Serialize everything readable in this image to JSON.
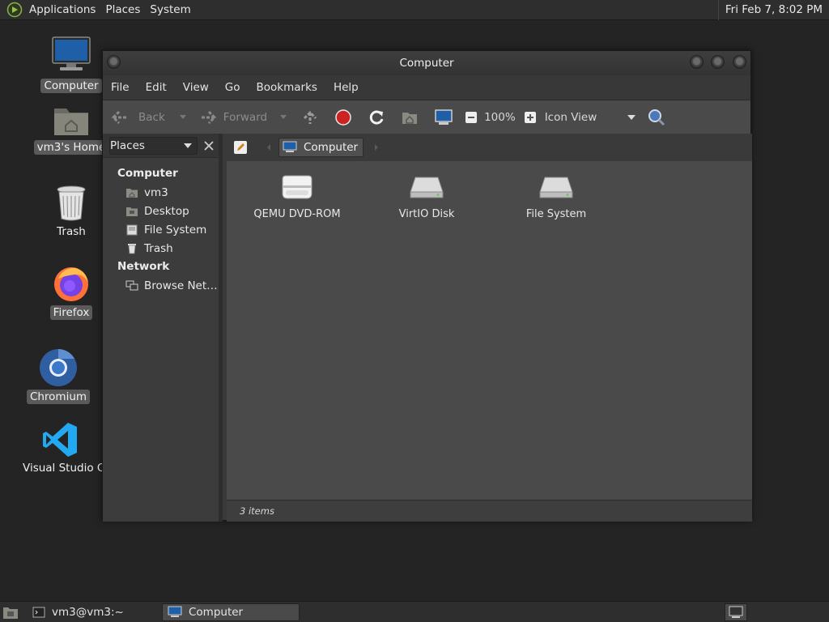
{
  "top_panel": {
    "menus": [
      "Applications",
      "Places",
      "System"
    ],
    "clock": "Fri Feb  7,  8:02 PM"
  },
  "desktop_icons": [
    {
      "label": "Computer",
      "icon": "computer-icon",
      "selected": true
    },
    {
      "label": "vm3's Home",
      "icon": "home-folder-icon",
      "selected": true
    },
    {
      "label": "Trash",
      "icon": "trash-icon",
      "selected": false
    },
    {
      "label": "Firefox",
      "icon": "firefox-icon",
      "selected": true
    },
    {
      "label": "Chromium",
      "icon": "chromium-icon",
      "selected": true
    },
    {
      "label": "Visual Studio Code",
      "icon": "vscode-icon",
      "selected": false
    }
  ],
  "window": {
    "title": "Computer",
    "menu": [
      "File",
      "Edit",
      "View",
      "Go",
      "Bookmarks",
      "Help"
    ],
    "toolbar": {
      "back": "Back",
      "forward": "Forward",
      "zoom": "100%",
      "view_mode": "Icon View"
    },
    "sidebar": {
      "selector": "Places",
      "categories": [
        {
          "label": "Computer",
          "items": [
            {
              "label": "vm3",
              "icon": "home-folder-icon"
            },
            {
              "label": "Desktop",
              "icon": "desktop-folder-icon"
            },
            {
              "label": "File System",
              "icon": "drive-icon"
            },
            {
              "label": "Trash",
              "icon": "trash-icon"
            }
          ]
        },
        {
          "label": "Network",
          "items": [
            {
              "label": "Browse Net…",
              "icon": "network-icon"
            }
          ]
        }
      ]
    },
    "location": "Computer",
    "files": [
      {
        "label": "QEMU DVD-ROM",
        "icon": "optical-drive-icon"
      },
      {
        "label": "VirtIO Disk",
        "icon": "hard-disk-icon"
      },
      {
        "label": "File System",
        "icon": "hard-disk-icon"
      }
    ],
    "status": "3 items"
  },
  "taskbar": {
    "tasks": [
      {
        "label": "vm3@vm3:~",
        "icon": "terminal-icon",
        "active": false
      },
      {
        "label": "Computer",
        "icon": "computer-icon",
        "active": true
      }
    ]
  }
}
